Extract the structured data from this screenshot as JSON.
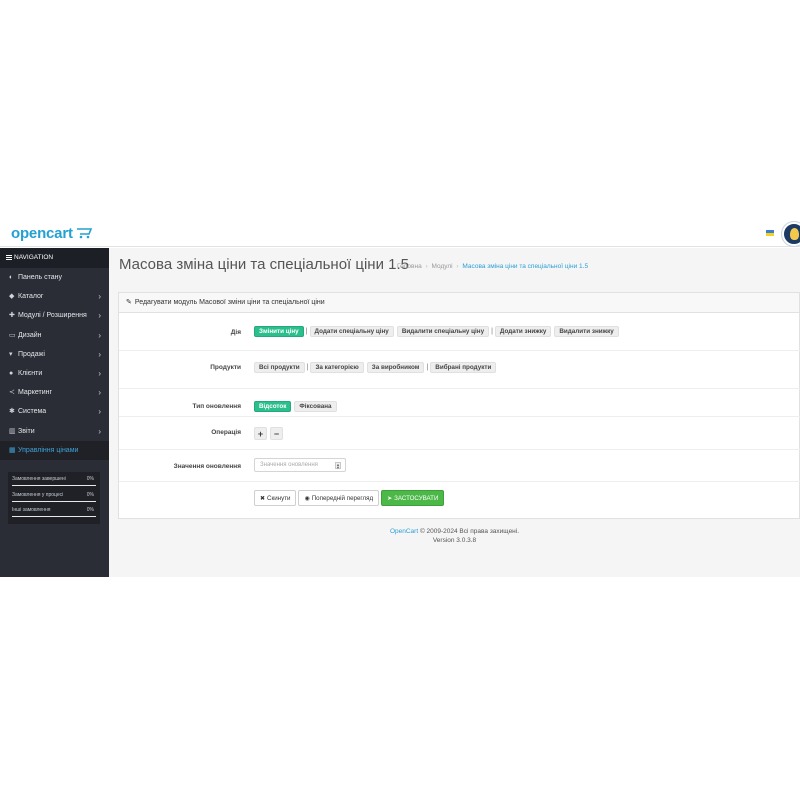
{
  "header": {
    "logo": "opencart"
  },
  "sidebar": {
    "title": "NAVIGATION",
    "items": [
      {
        "label": "Панель стану",
        "icon": "dashboard-icon",
        "glyph": "◐",
        "chevron": false
      },
      {
        "label": "Каталог",
        "icon": "tag-icon",
        "glyph": "◆",
        "chevron": true
      },
      {
        "label": "Модулі / Розширення",
        "icon": "puzzle-icon",
        "glyph": "✚",
        "chevron": true
      },
      {
        "label": "Дизайн",
        "icon": "monitor-icon",
        "glyph": "▭",
        "chevron": true
      },
      {
        "label": "Продажі",
        "icon": "cart-icon",
        "glyph": "▾",
        "chevron": true
      },
      {
        "label": "Клієнти",
        "icon": "user-icon",
        "glyph": "●",
        "chevron": true
      },
      {
        "label": "Маркетинг",
        "icon": "share-icon",
        "glyph": "≺",
        "chevron": true
      },
      {
        "label": "Система",
        "icon": "cog-icon",
        "glyph": "✱",
        "chevron": true
      },
      {
        "label": "Звіти",
        "icon": "bar-chart-icon",
        "glyph": "▥",
        "chevron": true
      },
      {
        "label": "Управління цінами",
        "icon": "calculator-icon",
        "glyph": "▦",
        "chevron": false,
        "active": true
      }
    ],
    "stats": [
      {
        "label": "Замовлення завершені",
        "percent": "0%",
        "fraction": 0
      },
      {
        "label": "Замовлення у процесі",
        "percent": "0%",
        "fraction": 0
      },
      {
        "label": "Інші замовлення",
        "percent": "0%",
        "fraction": 0
      }
    ]
  },
  "main": {
    "title": "Масова зміна ціни та спеціальної ціни 1.5",
    "breadcrumbs": [
      "Головна",
      "Модулі",
      "Масова зміна ціни та спеціальної ціни 1.5"
    ],
    "panel_title": "Редагувати модуль Масової зміни ціни та спеціальної ціни",
    "action_label": "Дія",
    "actions": [
      "Змінити ціну",
      "Додати спеціальну ціну",
      "Видалити спеціальну ціну",
      "Додати знижку",
      "Видалити знижку"
    ],
    "products_label": "Продукти",
    "products": [
      "Всі продукти",
      "За категорією",
      "За виробником",
      "Вибрані продукти"
    ],
    "update_type_label": "Тип оновлення",
    "update_types": [
      "Відсоток",
      "Фіксована"
    ],
    "operation_label": "Операція",
    "operations": [
      "+",
      "−"
    ],
    "value_label": "Значення оновлення",
    "value_placeholder": "Значення оновлення",
    "reset_label": "Скинути",
    "preview_label": "Попередній перегляд",
    "apply_label": "ЗАСТОСУВАТИ"
  },
  "footer": {
    "brand": "OpenCart",
    "copyright": " © 2009-2024 Всі права захищені.",
    "version": "Version 3.0.3.8"
  },
  "colors": {
    "accent": "#2a9fd6",
    "active_button": "#2bbf8e",
    "apply_button": "#4bb848",
    "sidebar_bg": "#2a2d35"
  }
}
